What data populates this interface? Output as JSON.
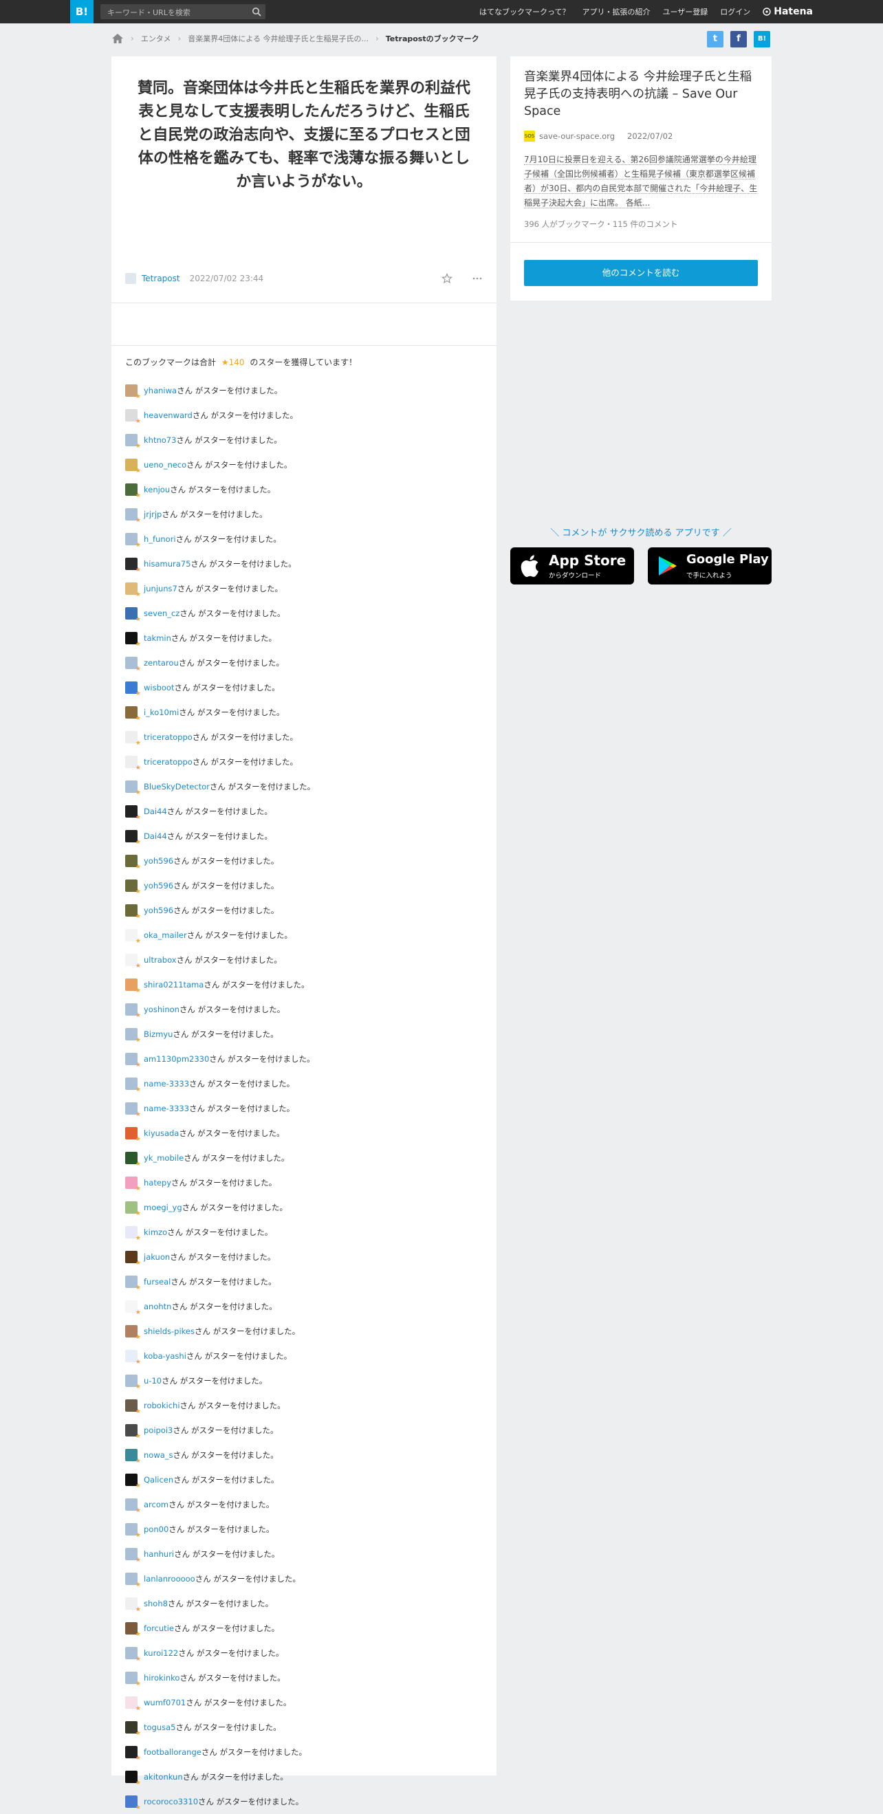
{
  "topbar": {
    "logo": "B!",
    "search_placeholder": "キーワード・URLを検索",
    "nav": [
      "はてなブックマークって？",
      "アプリ・拡張の紹介",
      "ユーザー登録",
      "ログイン"
    ],
    "brand": "Hatena"
  },
  "breadcrumb": {
    "items": [
      "エンタメ",
      "音楽業界4団体による 今井絵理子氏と生稲晃子氏の..."
    ],
    "current": "Tetrapostのブックマーク"
  },
  "share": {
    "twitter": "t",
    "facebook": "f",
    "hatena": "B!"
  },
  "comment": {
    "text": "賛同。音楽団体は今井氏と生稲氏を業界の利益代表と見なして支援表明したんだろうけど、生稲氏と自民党の政治志向や、支援に至るプロセスと団体の性格を鑑みても、軽率で浅薄な振る舞いとしか言いようがない。",
    "user": "Tetrapost",
    "date": "2022/07/02 23:44"
  },
  "stars_summary": {
    "prefix": "このブックマークは合計",
    "count": "140",
    "suffix": "のスターを獲得しています！"
  },
  "star_suffix": "さん がスターを付けました。",
  "star_users": [
    "yhaniwa",
    "heavenward",
    "khtno73",
    "ueno_neco",
    "kenjou",
    "jrjrjp",
    "h_funori",
    "hisamura75",
    "junjuns7",
    "seven_cz",
    "takmin",
    "zentarou",
    "wisboot",
    "i_ko10mi",
    "triceratoppo",
    "triceratoppo",
    "BlueSkyDetector",
    "Dai44",
    "Dai44",
    "yoh596",
    "yoh596",
    "yoh596",
    "oka_mailer",
    "ultrabox",
    "shira0211tama",
    "yoshinon",
    "Bizmyu",
    "am1130pm2330",
    "name-3333",
    "name-3333",
    "kiyusada",
    "yk_mobile",
    "hatepy",
    "moegi_yg",
    "kimzo",
    "jakuon",
    "furseal",
    "anohtn",
    "shields-pikes",
    "koba-yashi",
    "u-10",
    "robokichi",
    "poipoi3",
    "nowa_s",
    "Qalicen",
    "arcom",
    "pon00",
    "hanhuri",
    "lanlanrooooo",
    "shoh8",
    "forcutie",
    "kuroi122",
    "hirokinko",
    "wumf0701",
    "togusa5",
    "footballorange",
    "akitonkun",
    "rocoroco3310"
  ],
  "avatar_colors": [
    "#c9a27a",
    "#dcdcdc",
    "#a9bfd6",
    "#d9b15a",
    "#4b6b3a",
    "#a9bfd6",
    "#a9bfd6",
    "#2b2b2b",
    "#e0b878",
    "#3a6fb0",
    "#111111",
    "#a9bfd6",
    "#3a7bd5",
    "#8a6a3a",
    "#eeeeee",
    "#eeeeee",
    "#a9bfd6",
    "#222222",
    "#222222",
    "#6b6b3a",
    "#6b6b3a",
    "#6b6b3a",
    "#f4f4f4",
    "#f4f4f4",
    "#e8a060",
    "#a9bfd6",
    "#a9bfd6",
    "#a9bfd6",
    "#a9bfd6",
    "#a9bfd6",
    "#e06030",
    "#2a5a2a",
    "#f3a0c0",
    "#9fc080",
    "#e8e8f8",
    "#5a3a1a",
    "#a9bfd6",
    "#f6f6f6",
    "#b08060",
    "#e8eef8",
    "#a9bfd6",
    "#6a5a4a",
    "#4a4a4a",
    "#3a8a9a",
    "#111111",
    "#a9bfd6",
    "#a9bfd6",
    "#a9bfd6",
    "#a9bfd6",
    "#f0f0f0",
    "#7a5a3a",
    "#a9bfd6",
    "#a9bfd6",
    "#f8e0e8",
    "#3a3a2a",
    "#222222",
    "#111111",
    "#4a7ad0"
  ],
  "entry": {
    "title": "音楽業界4団体による 今井絵理子氏と生稲晃子氏の支持表明への抗議 – Save Our Space",
    "favicon_text": "SOS",
    "site": "save-our-space.org",
    "date": "2022/07/02",
    "excerpt": "7月10日に投票日を迎える、第26回参議院通常選挙の今井絵理子候補（全国比例候補者）と生稲晃子候補（東京都選挙区候補者）が30日、都内の自民党本部で開催された「今井絵理子、生稲晃子決起大会」に出席。 各紙...",
    "counts": "396 人がブックマーク・115 件のコメント",
    "read_more": "他のコメントを読む"
  },
  "promo": {
    "tagline": "＼ コメントが サクサク読める アプリです ／",
    "appstore_big": "App Store",
    "appstore_small": "からダウンロード",
    "googleplay_big": "Google Play",
    "googleplay_small": "で手に入れよう"
  },
  "colors": {
    "accent": "#00a4de",
    "link": "#1a8ad0",
    "star": "#f5a623",
    "twitter": "#55acee",
    "facebook": "#3b5998"
  }
}
